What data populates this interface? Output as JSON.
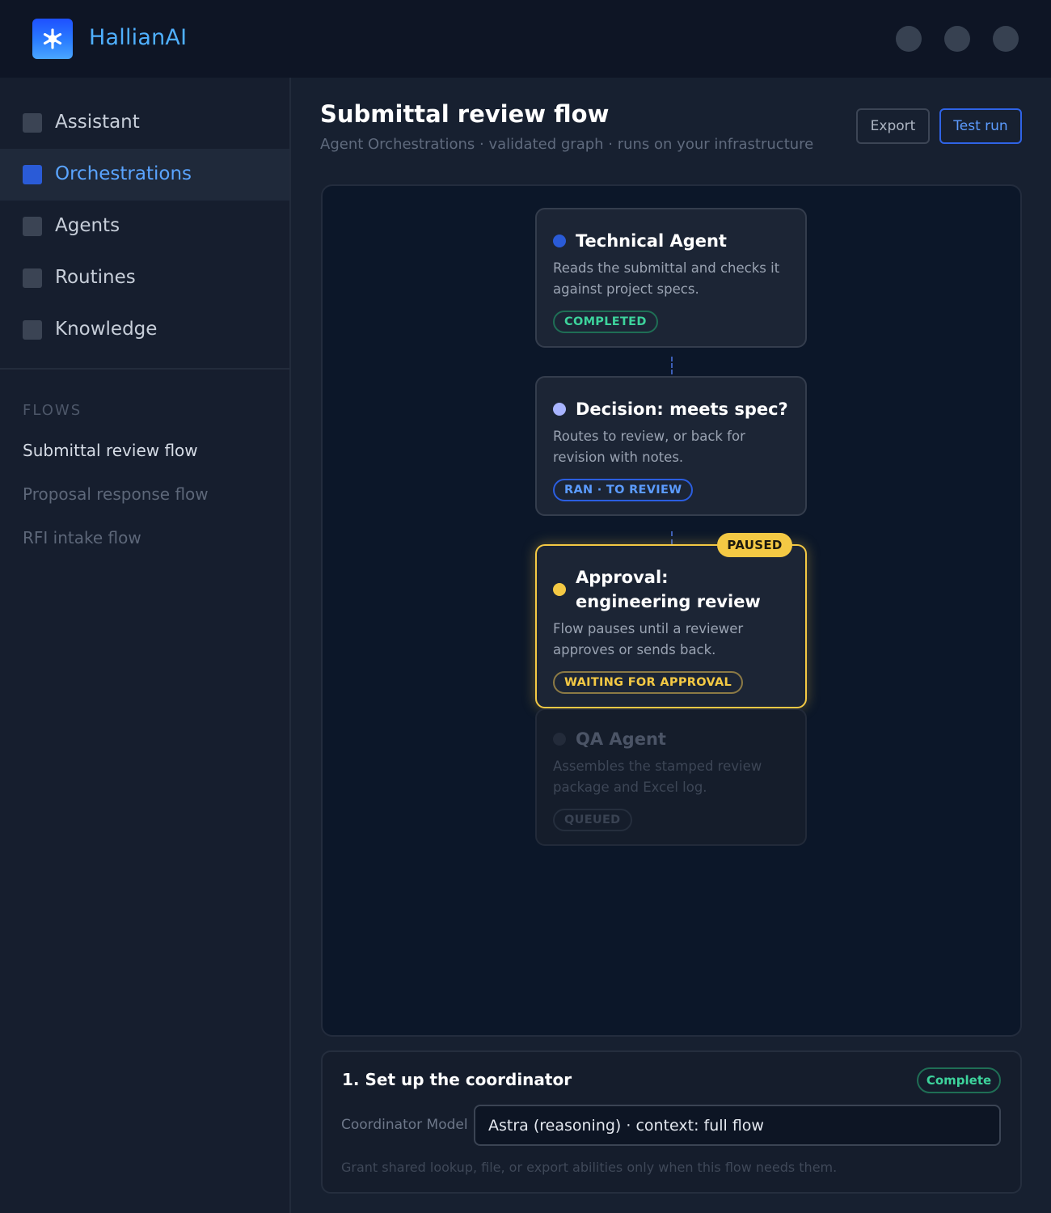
{
  "app": {
    "brand": "HallianAI"
  },
  "sidebar": {
    "items": [
      {
        "label": "Assistant",
        "active": false
      },
      {
        "label": "Orchestrations",
        "active": true
      },
      {
        "label": "Agents",
        "active": false
      },
      {
        "label": "Routines",
        "active": false
      },
      {
        "label": "Knowledge",
        "active": false
      }
    ],
    "flows_heading": "FLOWS",
    "flows": [
      {
        "label": "Submittal review flow",
        "current": true
      },
      {
        "label": "Proposal response flow",
        "current": false
      },
      {
        "label": "RFI intake flow",
        "current": false
      }
    ]
  },
  "header": {
    "title": "Submittal review flow",
    "subtitle": "Agent Orchestrations · validated graph · runs on your infrastructure",
    "export_label": "Export",
    "test_run_label": "Test run"
  },
  "graph": {
    "nodes": [
      {
        "title": "Technical Agent",
        "description": "Reads the submittal and checks it against project specs.",
        "status": "COMPLETED",
        "dot_color": "#2a5bd7"
      },
      {
        "title": "Decision: meets spec?",
        "description": "Routes to review, or back for revision with notes.",
        "status": "RAN · TO REVIEW",
        "dot_color": "#a8b4ff"
      },
      {
        "title": "Approval: engineering review",
        "description": "Flow pauses until a reviewer approves or sends back.",
        "status": "WAITING FOR APPROVAL",
        "tag": "PAUSED",
        "dot_color": "#f4c944"
      },
      {
        "title": "QA Agent",
        "description": "Assembles the stamped review package and Excel log.",
        "status": "QUEUED",
        "dot_color": "#232b3a"
      }
    ]
  },
  "setup": {
    "title": "1. Set up the coordinator",
    "status": "Complete",
    "field_label": "Coordinator Model",
    "field_value": "Astra (reasoning) · context: full flow",
    "hint": "Grant shared lookup, file, or export abilities only when this flow needs them."
  }
}
